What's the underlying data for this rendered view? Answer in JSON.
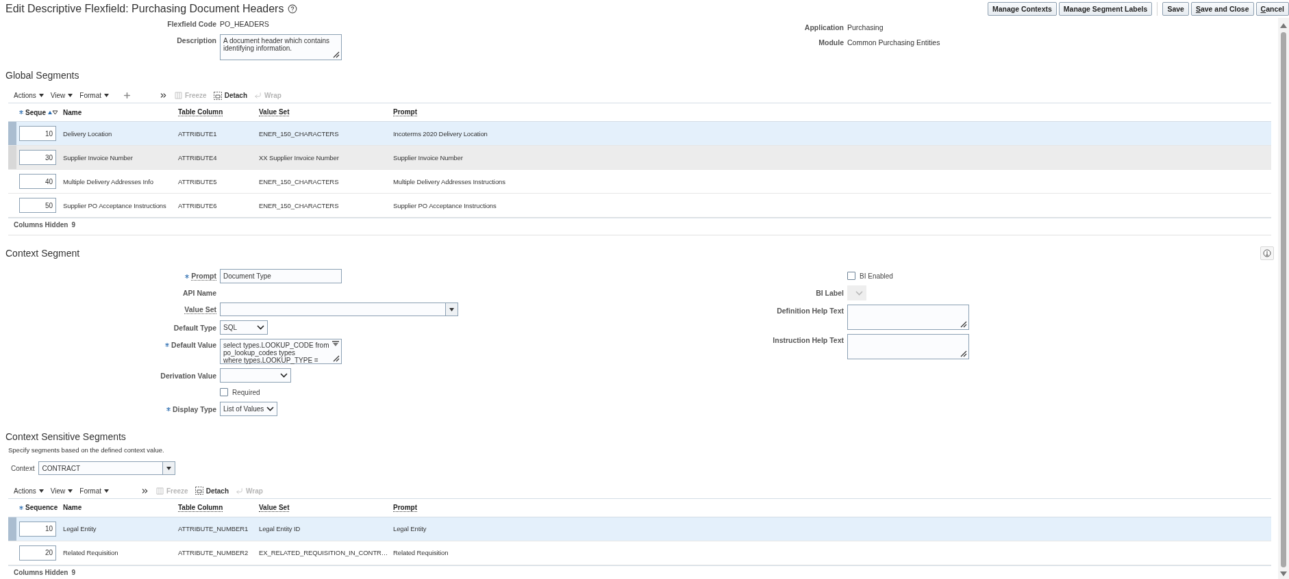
{
  "page": {
    "title": "Edit Descriptive Flexfield: Purchasing Document Headers"
  },
  "header_buttons": [
    {
      "kind": "button",
      "label": "Manage Contexts",
      "mnemonic": false
    },
    {
      "kind": "button",
      "label": "Manage Segment Labels",
      "mnemonic": false
    },
    {
      "kind": "separator"
    },
    {
      "kind": "button",
      "label": "Save",
      "mnemonic": false
    },
    {
      "kind": "button",
      "label": "Save and Close",
      "mnemonic": true
    },
    {
      "kind": "button",
      "label": "Cancel",
      "mnemonic": true
    }
  ],
  "details": {
    "left": [
      {
        "kind": "static",
        "label": "Flexfield Code",
        "value": "PO_HEADERS"
      },
      {
        "kind": "textarea",
        "label": "Description",
        "value": "A document header which contains identifying information."
      }
    ],
    "right": [
      {
        "kind": "static",
        "label": "Application",
        "value": "Purchasing"
      },
      {
        "kind": "static",
        "label": "Module",
        "value": "Common Purchasing Entities"
      }
    ]
  },
  "global_segments": {
    "title": "Global Segments",
    "toolbar": {
      "menus": [
        "Actions",
        "View",
        "Format"
      ],
      "add_button": true,
      "actions": [
        {
          "kind": "freeze",
          "label": "Freeze",
          "disabled": true
        },
        {
          "kind": "detach",
          "label": "Detach",
          "disabled": false
        },
        {
          "kind": "wrap",
          "label": "Wrap",
          "disabled": true
        }
      ]
    },
    "columns": [
      {
        "label": "Seque",
        "required": true,
        "sort_icons": true,
        "has_help": false
      },
      {
        "label": "Name",
        "required": false,
        "sort_icons": false,
        "has_help": false
      },
      {
        "label": "Table Column",
        "required": false,
        "sort_icons": false,
        "has_help": true
      },
      {
        "label": "Value Set",
        "required": false,
        "sort_icons": false,
        "has_help": true
      },
      {
        "label": "Prompt",
        "required": false,
        "sort_icons": false,
        "has_help": true
      }
    ],
    "rows": [
      {
        "sequence": "10",
        "name": "Delivery Location",
        "table_column": "ATTRIBUTE1",
        "value_set": "ENER_150_CHARACTERS",
        "prompt": "Incoterms 2020 Delivery Location",
        "selected": true,
        "highlighted": false
      },
      {
        "sequence": "30",
        "name": "Supplier Invoice Number",
        "table_column": "ATTRIBUTE4",
        "value_set": "XX Supplier Invoice Number",
        "prompt": "Supplier Invoice Number",
        "selected": false,
        "highlighted": true
      },
      {
        "sequence": "40",
        "name": "Multiple Delivery Addresses Info",
        "table_column": "ATTRIBUTE5",
        "value_set": "ENER_150_CHARACTERS",
        "prompt": "Multiple Delivery Addresses Instructions",
        "selected": false,
        "highlighted": false
      },
      {
        "sequence": "50",
        "name": "Supplier PO Acceptance Instructions",
        "table_column": "ATTRIBUTE6",
        "value_set": "ENER_150_CHARACTERS",
        "prompt": "Supplier PO Acceptance Instructions",
        "selected": false,
        "highlighted": false
      }
    ],
    "footer": {
      "label": "Columns Hidden",
      "count": "9"
    }
  },
  "context_segment": {
    "title": "Context Segment",
    "left": [
      {
        "kind": "text",
        "label": "Prompt",
        "value": "Document Type",
        "required": true,
        "has_help": true
      },
      {
        "kind": "static",
        "label": "API Name",
        "required": false,
        "has_help": false
      },
      {
        "kind": "lov",
        "label": "Value Set",
        "required": false,
        "has_help": true
      },
      {
        "kind": "select",
        "label": "Default Type",
        "value": "SQL",
        "required": false,
        "has_help": false,
        "disabled": false
      },
      {
        "kind": "code",
        "label": "Default Value",
        "value": "select types.LOOKUP_CODE from\npo_lookup_codes types\nwhere types.LOOKUP_TYPE =",
        "required": true,
        "has_help": false
      },
      {
        "kind": "select",
        "label": "Derivation Value",
        "required": false,
        "has_help": false,
        "disabled": false
      },
      {
        "kind": "checkbox",
        "label": "Required",
        "checked": false
      },
      {
        "kind": "select",
        "label": "Display Type",
        "value": "List of Values",
        "required": true,
        "has_help": false,
        "disabled": false
      }
    ],
    "right": [
      {
        "kind": "checkbox",
        "label": "BI Enabled",
        "checked": false
      },
      {
        "kind": "select",
        "label": "BI Label",
        "required": false,
        "has_help": false,
        "disabled": true
      },
      {
        "kind": "textarea",
        "label": "Definition Help Text",
        "required": false,
        "has_help": false
      },
      {
        "kind": "textarea",
        "label": "Instruction Help Text",
        "required": false,
        "has_help": false
      }
    ]
  },
  "context_sensitive_segments": {
    "title": "Context Sensitive Segments",
    "description": "Specify segments based on the defined context value.",
    "context": {
      "label": "Context",
      "value": "CONTRACT"
    },
    "toolbar": {
      "menus": [
        "Actions",
        "View",
        "Format"
      ],
      "add_button": false,
      "actions": [
        {
          "kind": "freeze",
          "label": "Freeze",
          "disabled": true
        },
        {
          "kind": "detach",
          "label": "Detach",
          "disabled": false
        },
        {
          "kind": "wrap",
          "label": "Wrap",
          "disabled": true
        }
      ]
    },
    "columns": [
      {
        "label": "Sequence",
        "required": true,
        "sort_icons": false,
        "has_help": false
      },
      {
        "label": "Name",
        "required": false,
        "sort_icons": false,
        "has_help": false
      },
      {
        "label": "Table Column",
        "required": false,
        "sort_icons": false,
        "has_help": true
      },
      {
        "label": "Value Set",
        "required": false,
        "sort_icons": false,
        "has_help": true
      },
      {
        "label": "Prompt",
        "required": false,
        "sort_icons": false,
        "has_help": true
      }
    ],
    "rows": [
      {
        "sequence": "10",
        "name": "Legal Entity",
        "table_column": "ATTRIBUTE_NUMBER1",
        "value_set": "Legal Entity ID",
        "prompt": "Legal Entity",
        "selected": true,
        "highlighted": false
      },
      {
        "sequence": "20",
        "name": "Related Requisition",
        "table_column": "ATTRIBUTE_NUMBER2",
        "value_set": "EX_RELATED_REQUISITION_IN_CONTR…",
        "prompt": "Related Requisition",
        "selected": false,
        "highlighted": false
      }
    ],
    "footer": {
      "label": "Columns Hidden",
      "count": "9"
    }
  }
}
